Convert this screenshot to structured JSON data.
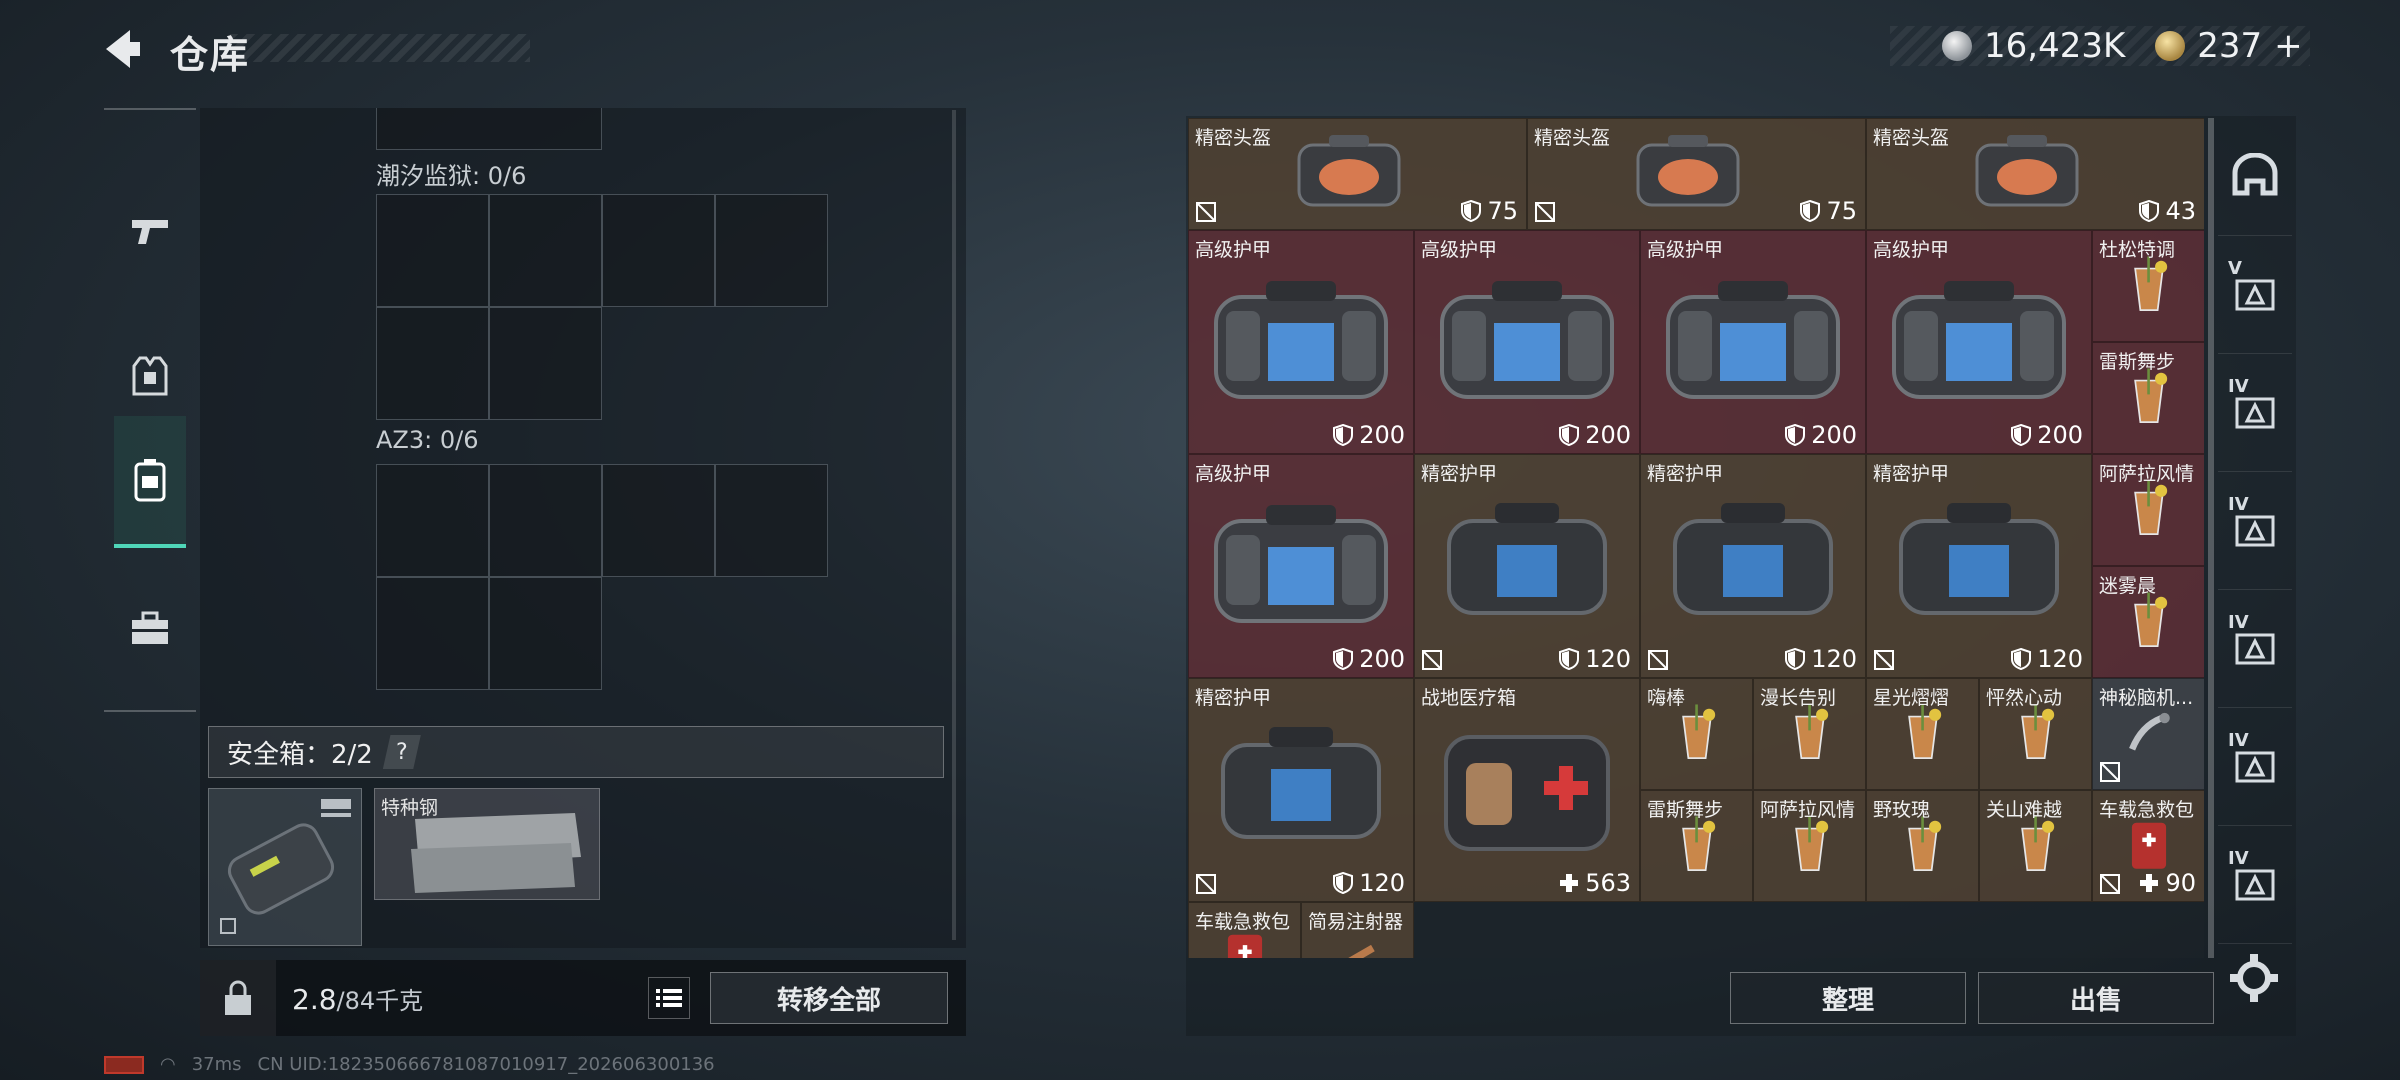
{
  "header": {
    "title": "仓库"
  },
  "currency": {
    "silver": "16,423K",
    "gold": "237",
    "gold_plus": "+"
  },
  "left_nav": {
    "items": [
      {
        "name": "weapon"
      },
      {
        "name": "armor"
      },
      {
        "name": "backpack"
      },
      {
        "name": "toolbox"
      }
    ]
  },
  "containers": [
    {
      "label": "潮汐监狱: 0/6"
    },
    {
      "label": "AZ3: 0/6"
    }
  ],
  "safe_box": {
    "label": "安全箱：2/2",
    "help": "?"
  },
  "safe_item": {
    "name": "特种钢"
  },
  "weight": {
    "current": "2.8",
    "max": "/84千克"
  },
  "transfer_all": "转移全部",
  "grid_items": [
    {
      "name": "精密头盔",
      "value": "75",
      "kind": "helmet",
      "bg": "brown",
      "nolink": true
    },
    {
      "name": "精密头盔",
      "value": "75",
      "kind": "helmet",
      "bg": "brown",
      "nolink": true
    },
    {
      "name": "精密头盔",
      "value": "43",
      "kind": "helmet",
      "bg": "brown",
      "nolink": false
    },
    {
      "name": "高级护甲",
      "value": "200",
      "kind": "armor",
      "bg": "red",
      "nolink": false
    },
    {
      "name": "高级护甲",
      "value": "200",
      "kind": "armor",
      "bg": "red",
      "nolink": false
    },
    {
      "name": "高级护甲",
      "value": "200",
      "kind": "armor",
      "bg": "red",
      "nolink": false
    },
    {
      "name": "高级护甲",
      "value": "200",
      "kind": "armor",
      "bg": "red",
      "nolink": false
    },
    {
      "name": "杜松特调",
      "value": "",
      "kind": "drink",
      "bg": "red"
    },
    {
      "name": "雷斯舞步",
      "value": "",
      "kind": "drink",
      "bg": "red"
    },
    {
      "name": "高级护甲",
      "value": "200",
      "kind": "armor",
      "bg": "red",
      "nolink": false
    },
    {
      "name": "精密护甲",
      "value": "120",
      "kind": "vest",
      "bg": "brown",
      "nolink": true
    },
    {
      "name": "精密护甲",
      "value": "120",
      "kind": "vest",
      "bg": "brown",
      "nolink": true
    },
    {
      "name": "精密护甲",
      "value": "120",
      "kind": "vest",
      "bg": "brown",
      "nolink": true
    },
    {
      "name": "阿萨拉风情",
      "value": "",
      "kind": "drink",
      "bg": "red"
    },
    {
      "name": "迷雾晨",
      "value": "",
      "kind": "drink",
      "bg": "red"
    },
    {
      "name": "精密护甲",
      "value": "120",
      "kind": "vest",
      "bg": "brown",
      "nolink": true
    },
    {
      "name": "战地医疗箱",
      "value": "563",
      "kind": "medkit",
      "bg": "brown"
    },
    {
      "name": "嗨棒",
      "value": "",
      "kind": "drink",
      "bg": "brown"
    },
    {
      "name": "漫长告别",
      "value": "",
      "kind": "drink",
      "bg": "brown"
    },
    {
      "name": "星光熠熠",
      "value": "",
      "kind": "drink",
      "bg": "brown"
    },
    {
      "name": "怦然心动",
      "value": "",
      "kind": "drink",
      "bg": "brown"
    },
    {
      "name": "神秘脑机...",
      "value": "",
      "kind": "gadget",
      "bg": "gray",
      "nolink": true
    },
    {
      "name": "雷斯舞步",
      "value": "",
      "kind": "drink",
      "bg": "brown"
    },
    {
      "name": "阿萨拉风情",
      "value": "",
      "kind": "drink",
      "bg": "brown"
    },
    {
      "name": "野玫瑰",
      "value": "",
      "kind": "drink",
      "bg": "brown"
    },
    {
      "name": "关山难越",
      "value": "",
      "kind": "drink",
      "bg": "brown"
    },
    {
      "name": "车载急救包",
      "value": "90",
      "kind": "firstaid",
      "bg": "brown",
      "nolink": true
    },
    {
      "name": "车载急救包",
      "value": "",
      "kind": "firstaid",
      "bg": "brown"
    },
    {
      "name": "简易注射器",
      "value": "",
      "kind": "syringe",
      "bg": "brown"
    }
  ],
  "side_tabs": [
    {
      "name": "all",
      "level": ""
    },
    {
      "name": "tier-v-gear",
      "level": "V"
    },
    {
      "name": "tier-iv-1",
      "level": "IV"
    },
    {
      "name": "tier-iv-2",
      "level": "IV"
    },
    {
      "name": "tier-iv-3",
      "level": "IV"
    },
    {
      "name": "tier-iv-4",
      "level": "IV"
    },
    {
      "name": "tier-iv-add",
      "level": "IV"
    }
  ],
  "buttons": {
    "sort": "整理",
    "sell": "出售"
  },
  "status": {
    "ping": "37ms",
    "uid": "CN UID:182350666781087010917_202606300136"
  },
  "colors": {
    "accent": "#4fd6b8",
    "cell_red": "#78343c",
    "cell_brown": "#705438"
  }
}
